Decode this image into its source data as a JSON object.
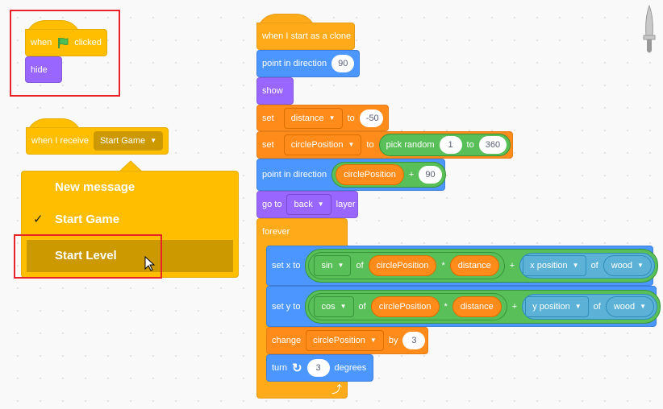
{
  "script1": {
    "when": "when",
    "flag_icon": "green-flag-icon",
    "clicked": "clicked",
    "hide": "hide"
  },
  "script2": {
    "when_receive": "when I receive",
    "message": "Start Game"
  },
  "dropdown": {
    "items": [
      {
        "label": "New message",
        "checked": false
      },
      {
        "label": "Start Game",
        "checked": true
      },
      {
        "label": "Start Level",
        "checked": false,
        "highlighted": true
      }
    ],
    "check": "✓"
  },
  "script3": {
    "hat": "when I start as a clone",
    "point1": {
      "label": "point in direction",
      "value": "90"
    },
    "show": "show",
    "set1": {
      "set": "set",
      "var": "distance",
      "to": "to",
      "value": "-50"
    },
    "set2": {
      "set": "set",
      "var": "circlePosition",
      "to": "to",
      "pick": "pick random",
      "from": "1",
      "to2": "to",
      "max": "360"
    },
    "point2": {
      "label": "point in direction",
      "var": "circlePosition",
      "op": "+",
      "value": "90"
    },
    "goto": {
      "label": "go to",
      "layer": "back",
      "suffix": "layer"
    },
    "forever": "forever",
    "setx": {
      "label": "set x to",
      "fn": "sin",
      "of": "of",
      "var": "circlePosition",
      "mul": "*",
      "var2": "distance",
      "plus": "+",
      "prop": "x position",
      "of2": "of",
      "sprite": "wood"
    },
    "sety": {
      "label": "set y to",
      "fn": "cos",
      "of": "of",
      "var": "circlePosition",
      "mul": "*",
      "var2": "distance",
      "plus": "+",
      "prop": "y position",
      "of2": "of",
      "sprite": "wood"
    },
    "change": {
      "label": "change",
      "var": "circlePosition",
      "by": "by",
      "value": "3"
    },
    "turn": {
      "label": "turn",
      "value": "3",
      "suffix": "degrees"
    }
  },
  "colors": {
    "events": "#FFBF00",
    "control": "#FFAB19",
    "motion": "#4C97FF",
    "looks": "#9966FF",
    "variables": "#FF8C1A",
    "operators": "#59C059",
    "sensing": "#5CB1D6",
    "highlight": "#e8232a"
  }
}
